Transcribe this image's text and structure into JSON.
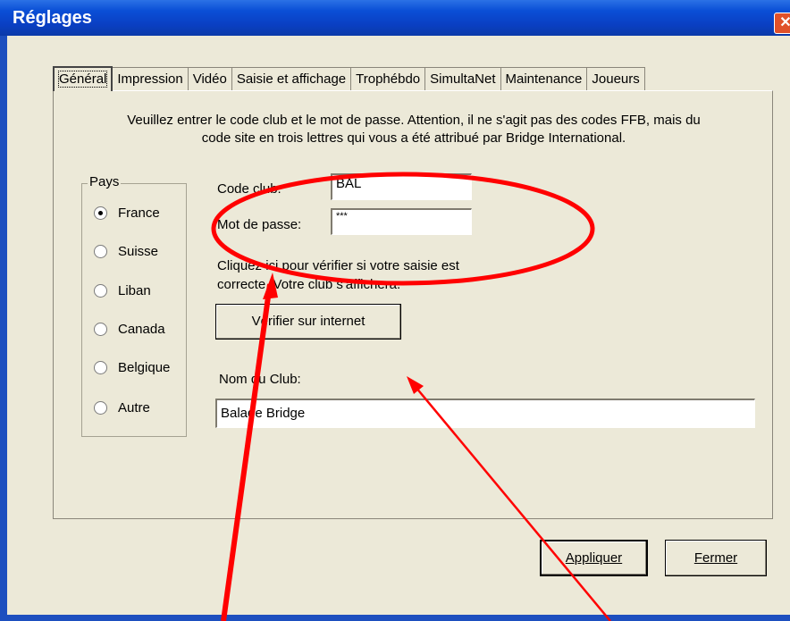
{
  "window": {
    "title": "Réglages",
    "close_glyph": "✕"
  },
  "tabs": [
    {
      "label": "Général",
      "active": true
    },
    {
      "label": "Impression"
    },
    {
      "label": "Vidéo"
    },
    {
      "label": "Saisie et affichage"
    },
    {
      "label": "Trophébdo"
    },
    {
      "label": "SimultaNet"
    },
    {
      "label": "Maintenance"
    },
    {
      "label": "Joueurs"
    }
  ],
  "general": {
    "intro_line1": "Veuillez entrer le code club et le mot de passe. Attention, il ne s'agit pas des codes FFB, mais du",
    "intro_line2": "code site en trois lettres qui vous a été attribué par Bridge International.",
    "country_group": {
      "title": "Pays",
      "options": [
        "France",
        "Suisse",
        "Liban",
        "Canada",
        "Belgique",
        "Autre"
      ],
      "selected": "France"
    },
    "code_club_label": "Code club:",
    "code_club_value": "BAL",
    "password_label": "Mot de passe:",
    "password_value": "***",
    "verify_hint_line1": "Cliquez ici pour vérifier si votre saisie est",
    "verify_hint_line2": "correcte. Votre club s'affichera.",
    "verify_button": "Vérifier sur internet",
    "club_name_label": "Nom du Club:",
    "club_name_value": "Balade Bridge"
  },
  "footer": {
    "apply_button": "Appliquer",
    "close_button": "Fermer"
  },
  "colors": {
    "annotation_red": "#ff0000",
    "titlebar_blue": "#0a4fd6"
  }
}
